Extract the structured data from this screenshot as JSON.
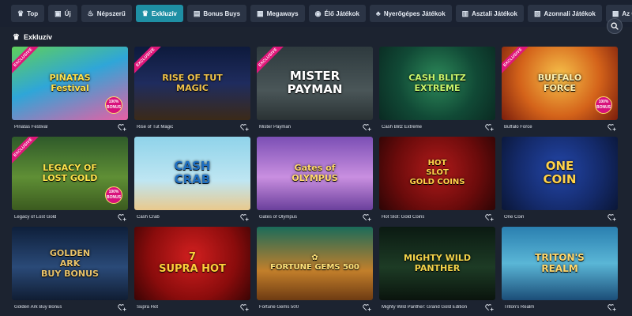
{
  "nav": {
    "tabs": [
      {
        "label": "Top",
        "icon": "crown-icon",
        "glyph": "♛",
        "active": false
      },
      {
        "label": "Új",
        "icon": "new-icon",
        "glyph": "▣",
        "active": false
      },
      {
        "label": "Népszerű",
        "icon": "fire-icon",
        "glyph": "♨",
        "active": false
      },
      {
        "label": "Exkluzív",
        "icon": "crown-icon",
        "glyph": "♛",
        "active": true
      },
      {
        "label": "Bonus Buys",
        "icon": "bonus-icon",
        "glyph": "▤",
        "active": false
      },
      {
        "label": "Megaways",
        "icon": "megaways-icon",
        "glyph": "▦",
        "active": false
      },
      {
        "label": "Élő Játékok",
        "icon": "live-icon",
        "glyph": "◉",
        "active": false
      },
      {
        "label": "Nyerőgépes Játékok",
        "icon": "slot-icon",
        "glyph": "♣",
        "active": false
      },
      {
        "label": "Asztali Játékok",
        "icon": "table-icon",
        "glyph": "▥",
        "active": false
      },
      {
        "label": "Azonnali Játékok",
        "icon": "instant-icon",
        "glyph": "▧",
        "active": false
      },
      {
        "label": "Az Összes",
        "icon": "all-icon",
        "glyph": "▩",
        "active": false
      }
    ]
  },
  "section": {
    "title": "Exkluzív"
  },
  "ribbon_text": "EXCLUSIVE",
  "games": [
    {
      "name": "Pinatas Festival",
      "logo": "PIÑATAS\nFestival",
      "exclusive": true,
      "badge": "100%\nBONUS",
      "bg": "linear-gradient(160deg,#5fcf5a 0%,#2fa6d8 45%,#e85fa3 100%)",
      "logo_color": "#ffe14d",
      "logo_size": 11
    },
    {
      "name": "Rise of Tut Magic",
      "logo": "RISE OF TUT\nMAGIC",
      "exclusive": true,
      "badge": "",
      "bg": "linear-gradient(180deg,#0d1a3c 0%,#1f2c5e 50%,#3b2a18 100%)",
      "logo_color": "#f0c34a",
      "logo_size": 11
    },
    {
      "name": "Mister Payman",
      "logo": "MISTER\nPAYMAN",
      "exclusive": true,
      "badge": "",
      "bg": "linear-gradient(180deg,#2e3a3e 0%,#4a5658 60%,#2a3234 100%)",
      "logo_color": "#ffffff",
      "logo_size": 15
    },
    {
      "name": "Cash Blitz Extreme",
      "logo": "CASH BLITZ\nEXTREME",
      "exclusive": false,
      "badge": "",
      "bg": "radial-gradient(circle at 50% 45%,#2d8a5a 0%,#114a36 55%,#0a2a22 100%)",
      "logo_color": "#c9f56b",
      "logo_size": 11
    },
    {
      "name": "Buffalo Force",
      "logo": "BUFFALO\nFORCE",
      "exclusive": true,
      "badge": "100%\nBONUS",
      "bg": "radial-gradient(circle at 50% 40%,#f6c14a 0%,#d4631a 55%,#7a1d0c 100%)",
      "logo_color": "#fff1b0",
      "logo_size": 11
    },
    {
      "name": "Legacy of Lost Gold",
      "logo": "LEGACY OF\nLOST GOLD",
      "exclusive": true,
      "badge": "100%\nBONUS",
      "bg": "linear-gradient(180deg,#2f5a2a 0%,#5f8f35 55%,#3b5a1f 100%)",
      "logo_color": "#ffe24a",
      "logo_size": 11
    },
    {
      "name": "Cash Crab",
      "logo": "CASH\nCRAB",
      "exclusive": false,
      "badge": "",
      "bg": "linear-gradient(180deg,#8fd3ea 0%,#bfe6f2 60%,#e9c98c 100%)",
      "logo_color": "#1e6fc2",
      "logo_size": 15
    },
    {
      "name": "Gates of Olympus",
      "logo": "Gates of\nOLYMPUS",
      "exclusive": false,
      "badge": "",
      "bg": "linear-gradient(180deg,#7b4fb5 0%,#c98fe0 55%,#6a3f9c 100%)",
      "logo_color": "#ffd86b",
      "logo_size": 11
    },
    {
      "name": "Hot Slot: Gold Coins",
      "logo": "HOT\nSLOT\nGOLD COINS",
      "exclusive": false,
      "badge": "",
      "bg": "radial-gradient(circle at 50% 45%,#b01a1a 0%,#6a0b0b 60%,#2d0505 100%)",
      "logo_color": "#ffd24a",
      "logo_size": 10
    },
    {
      "name": "One Coin",
      "logo": "ONE\nCOIN",
      "exclusive": false,
      "badge": "",
      "bg": "radial-gradient(circle at 50% 45%,#2346a8 0%,#142a6a 60%,#0a1636 100%)",
      "logo_color": "#ffd24a",
      "logo_size": 15
    },
    {
      "name": "Golden Ark Buy Bonus",
      "logo": "GOLDEN\nARK\nBUY BONUS",
      "exclusive": false,
      "badge": "",
      "bg": "linear-gradient(180deg,#0e1f3a 0%,#2a4a78 55%,#101d33 100%)",
      "logo_color": "#e9c36a",
      "logo_size": 11
    },
    {
      "name": "Supra Hot",
      "logo": "7\nSUPRA HOT",
      "exclusive": false,
      "badge": "",
      "bg": "radial-gradient(circle at 50% 40%,#d11f1f 0%,#8a0c0c 60%,#3a0404 100%)",
      "logo_color": "#ffcf3a",
      "logo_size": 13
    },
    {
      "name": "Fortune Gems 500",
      "logo": "✿\nFORTUNE GEMS 500",
      "exclusive": false,
      "badge": "",
      "bg": "linear-gradient(180deg,#1b6b5a 0%,#c27f2b 60%,#6e3b12 100%)",
      "logo_color": "#ffe37a",
      "logo_size": 10
    },
    {
      "name": "Mighty Wild Panther: Grand Gold Edition",
      "logo": "MIGHTY WILD\nPANTHER",
      "exclusive": false,
      "badge": "",
      "bg": "linear-gradient(180deg,#0b1a12 0%,#1d3b25 55%,#0a140d 100%)",
      "logo_color": "#f3d34a",
      "logo_size": 11
    },
    {
      "name": "Triton's Realm",
      "logo": "TRITON'S\nREALM",
      "exclusive": false,
      "badge": "",
      "bg": "linear-gradient(180deg,#2a7fb0 0%,#5ab6d6 50%,#1b4d78 100%)",
      "logo_color": "#ffd66b",
      "logo_size": 12
    }
  ]
}
